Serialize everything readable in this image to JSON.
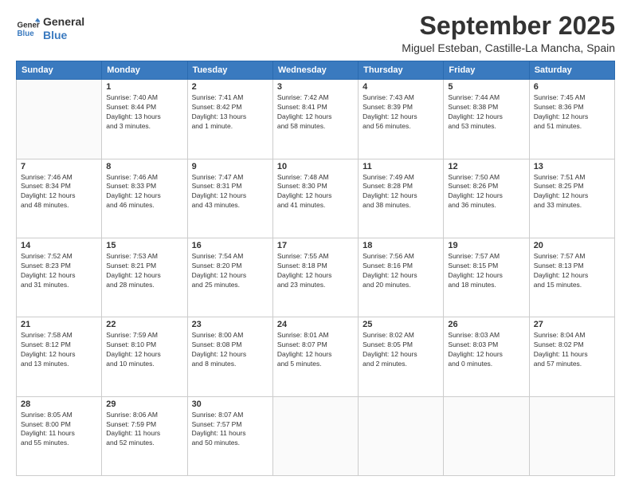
{
  "logo": {
    "line1": "General",
    "line2": "Blue"
  },
  "title": "September 2025",
  "subtitle": "Miguel Esteban, Castille-La Mancha, Spain",
  "weekdays": [
    "Sunday",
    "Monday",
    "Tuesday",
    "Wednesday",
    "Thursday",
    "Friday",
    "Saturday"
  ],
  "weeks": [
    [
      {
        "day": "",
        "info": ""
      },
      {
        "day": "1",
        "info": "Sunrise: 7:40 AM\nSunset: 8:44 PM\nDaylight: 13 hours\nand 3 minutes."
      },
      {
        "day": "2",
        "info": "Sunrise: 7:41 AM\nSunset: 8:42 PM\nDaylight: 13 hours\nand 1 minute."
      },
      {
        "day": "3",
        "info": "Sunrise: 7:42 AM\nSunset: 8:41 PM\nDaylight: 12 hours\nand 58 minutes."
      },
      {
        "day": "4",
        "info": "Sunrise: 7:43 AM\nSunset: 8:39 PM\nDaylight: 12 hours\nand 56 minutes."
      },
      {
        "day": "5",
        "info": "Sunrise: 7:44 AM\nSunset: 8:38 PM\nDaylight: 12 hours\nand 53 minutes."
      },
      {
        "day": "6",
        "info": "Sunrise: 7:45 AM\nSunset: 8:36 PM\nDaylight: 12 hours\nand 51 minutes."
      }
    ],
    [
      {
        "day": "7",
        "info": "Sunrise: 7:46 AM\nSunset: 8:34 PM\nDaylight: 12 hours\nand 48 minutes."
      },
      {
        "day": "8",
        "info": "Sunrise: 7:46 AM\nSunset: 8:33 PM\nDaylight: 12 hours\nand 46 minutes."
      },
      {
        "day": "9",
        "info": "Sunrise: 7:47 AM\nSunset: 8:31 PM\nDaylight: 12 hours\nand 43 minutes."
      },
      {
        "day": "10",
        "info": "Sunrise: 7:48 AM\nSunset: 8:30 PM\nDaylight: 12 hours\nand 41 minutes."
      },
      {
        "day": "11",
        "info": "Sunrise: 7:49 AM\nSunset: 8:28 PM\nDaylight: 12 hours\nand 38 minutes."
      },
      {
        "day": "12",
        "info": "Sunrise: 7:50 AM\nSunset: 8:26 PM\nDaylight: 12 hours\nand 36 minutes."
      },
      {
        "day": "13",
        "info": "Sunrise: 7:51 AM\nSunset: 8:25 PM\nDaylight: 12 hours\nand 33 minutes."
      }
    ],
    [
      {
        "day": "14",
        "info": "Sunrise: 7:52 AM\nSunset: 8:23 PM\nDaylight: 12 hours\nand 31 minutes."
      },
      {
        "day": "15",
        "info": "Sunrise: 7:53 AM\nSunset: 8:21 PM\nDaylight: 12 hours\nand 28 minutes."
      },
      {
        "day": "16",
        "info": "Sunrise: 7:54 AM\nSunset: 8:20 PM\nDaylight: 12 hours\nand 25 minutes."
      },
      {
        "day": "17",
        "info": "Sunrise: 7:55 AM\nSunset: 8:18 PM\nDaylight: 12 hours\nand 23 minutes."
      },
      {
        "day": "18",
        "info": "Sunrise: 7:56 AM\nSunset: 8:16 PM\nDaylight: 12 hours\nand 20 minutes."
      },
      {
        "day": "19",
        "info": "Sunrise: 7:57 AM\nSunset: 8:15 PM\nDaylight: 12 hours\nand 18 minutes."
      },
      {
        "day": "20",
        "info": "Sunrise: 7:57 AM\nSunset: 8:13 PM\nDaylight: 12 hours\nand 15 minutes."
      }
    ],
    [
      {
        "day": "21",
        "info": "Sunrise: 7:58 AM\nSunset: 8:12 PM\nDaylight: 12 hours\nand 13 minutes."
      },
      {
        "day": "22",
        "info": "Sunrise: 7:59 AM\nSunset: 8:10 PM\nDaylight: 12 hours\nand 10 minutes."
      },
      {
        "day": "23",
        "info": "Sunrise: 8:00 AM\nSunset: 8:08 PM\nDaylight: 12 hours\nand 8 minutes."
      },
      {
        "day": "24",
        "info": "Sunrise: 8:01 AM\nSunset: 8:07 PM\nDaylight: 12 hours\nand 5 minutes."
      },
      {
        "day": "25",
        "info": "Sunrise: 8:02 AM\nSunset: 8:05 PM\nDaylight: 12 hours\nand 2 minutes."
      },
      {
        "day": "26",
        "info": "Sunrise: 8:03 AM\nSunset: 8:03 PM\nDaylight: 12 hours\nand 0 minutes."
      },
      {
        "day": "27",
        "info": "Sunrise: 8:04 AM\nSunset: 8:02 PM\nDaylight: 11 hours\nand 57 minutes."
      }
    ],
    [
      {
        "day": "28",
        "info": "Sunrise: 8:05 AM\nSunset: 8:00 PM\nDaylight: 11 hours\nand 55 minutes."
      },
      {
        "day": "29",
        "info": "Sunrise: 8:06 AM\nSunset: 7:59 PM\nDaylight: 11 hours\nand 52 minutes."
      },
      {
        "day": "30",
        "info": "Sunrise: 8:07 AM\nSunset: 7:57 PM\nDaylight: 11 hours\nand 50 minutes."
      },
      {
        "day": "",
        "info": ""
      },
      {
        "day": "",
        "info": ""
      },
      {
        "day": "",
        "info": ""
      },
      {
        "day": "",
        "info": ""
      }
    ]
  ]
}
